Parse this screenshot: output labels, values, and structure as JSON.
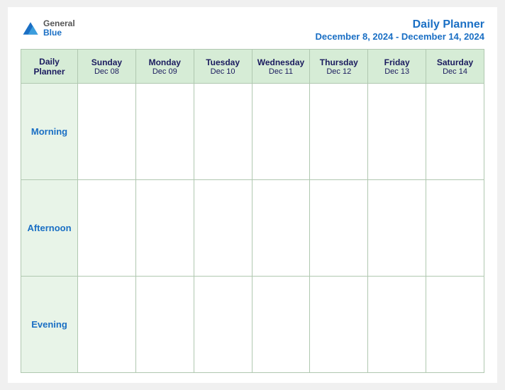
{
  "logo": {
    "general": "General",
    "blue": "Blue"
  },
  "title": {
    "main": "Daily Planner",
    "date_range": "December 8, 2024 - December 14, 2024"
  },
  "columns": [
    {
      "id": "daily-planner-col",
      "day": "Daily",
      "day2": "Planner",
      "date": ""
    },
    {
      "id": "sun",
      "day": "Sunday",
      "date": "Dec 08"
    },
    {
      "id": "mon",
      "day": "Monday",
      "date": "Dec 09"
    },
    {
      "id": "tue",
      "day": "Tuesday",
      "date": "Dec 10"
    },
    {
      "id": "wed",
      "day": "Wednesday",
      "date": "Dec 11"
    },
    {
      "id": "thu",
      "day": "Thursday",
      "date": "Dec 12"
    },
    {
      "id": "fri",
      "day": "Friday",
      "date": "Dec 13"
    },
    {
      "id": "sat",
      "day": "Saturday",
      "date": "Dec 14"
    }
  ],
  "rows": [
    {
      "label": "Morning"
    },
    {
      "label": "Afternoon"
    },
    {
      "label": "Evening"
    }
  ]
}
